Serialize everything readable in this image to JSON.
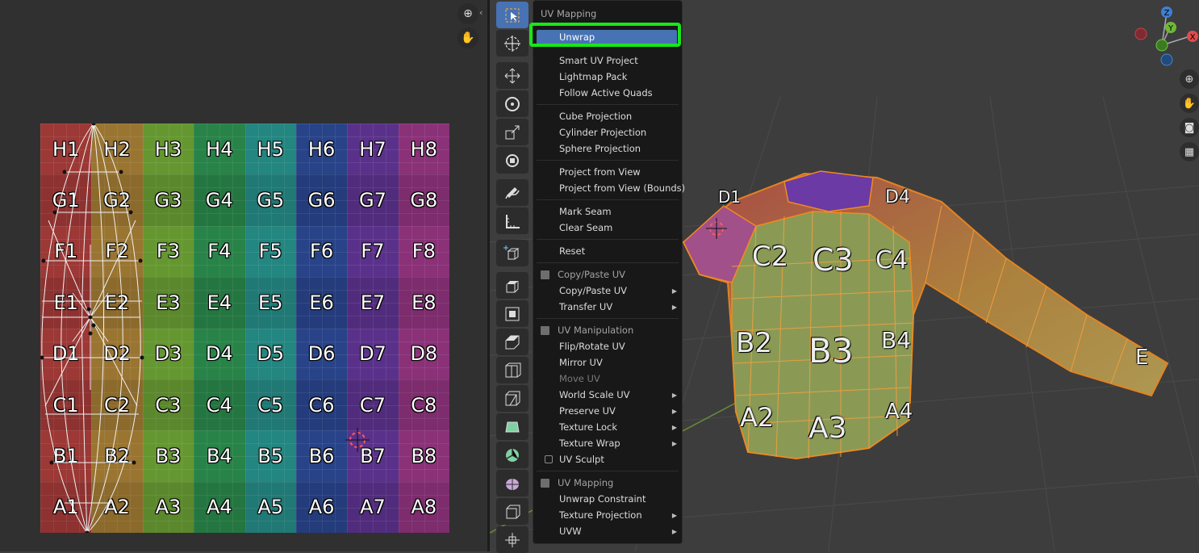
{
  "uv_grid": {
    "rows": [
      [
        "H1",
        "H2",
        "H3",
        "H4",
        "H5",
        "H6",
        "H7",
        "H8"
      ],
      [
        "G1",
        "G2",
        "G3",
        "G4",
        "G5",
        "G6",
        "G7",
        "G8"
      ],
      [
        "F1",
        "F2",
        "F3",
        "F4",
        "F5",
        "F6",
        "F7",
        "F8"
      ],
      [
        "E1",
        "E2",
        "E3",
        "E4",
        "E5",
        "E6",
        "E7",
        "E8"
      ],
      [
        "D1",
        "D2",
        "D3",
        "D4",
        "D5",
        "D6",
        "D7",
        "D8"
      ],
      [
        "C1",
        "C2",
        "C3",
        "C4",
        "C5",
        "C6",
        "C7",
        "C8"
      ],
      [
        "B1",
        "B2",
        "B3",
        "B4",
        "B5",
        "B6",
        "B7",
        "B8"
      ],
      [
        "A1",
        "A2",
        "A3",
        "A4",
        "A5",
        "A6",
        "A7",
        "A8"
      ]
    ],
    "column_colors": [
      "#b8423f",
      "#b68a3a",
      "#77b23a",
      "#2f9a55",
      "#2a9e97",
      "#2f4fa0",
      "#6a3aa3",
      "#a33a8e"
    ]
  },
  "menu": {
    "title": "UV Mapping",
    "items": {
      "unwrap": "Unwrap",
      "smart_uv_project": "Smart UV Project",
      "lightmap_pack": "Lightmap Pack",
      "follow_active_quads": "Follow Active Quads",
      "cube_projection": "Cube Projection",
      "cylinder_projection": "Cylinder Projection",
      "sphere_projection": "Sphere Projection",
      "project_from_view": "Project from View",
      "project_from_view_bounds": "Project from View (Bounds)",
      "mark_seam": "Mark Seam",
      "clear_seam": "Clear Seam",
      "reset": "Reset",
      "copy_paste_header": "Copy/Paste UV",
      "copy_paste_uv": "Copy/Paste UV",
      "transfer_uv": "Transfer UV",
      "uv_manipulation_header": "UV Manipulation",
      "flip_rotate_uv": "Flip/Rotate UV",
      "mirror_uv": "Mirror UV",
      "move_uv": "Move UV",
      "world_scale_uv": "World Scale UV",
      "preserve_uv": "Preserve UV",
      "texture_lock": "Texture Lock",
      "texture_wrap": "Texture Wrap",
      "uv_sculpt": "UV Sculpt",
      "uv_mapping_header": "UV Mapping",
      "unwrap_constraint": "Unwrap Constraint",
      "texture_projection": "Texture Projection",
      "uvw": "UVW"
    }
  },
  "gizmo": {
    "z": "Z",
    "y": "Y",
    "x": "X"
  },
  "shirt_labels": [
    "C2",
    "C3",
    "C4",
    "B2",
    "B3",
    "B4",
    "A2",
    "A3",
    "A4",
    "D1",
    "D4",
    "E"
  ],
  "icons": {
    "uv_zoom": "zoom-icon",
    "uv_pan": "hand-icon",
    "collapse": "chevron-left-icon"
  },
  "colors": {
    "accent": "#4772b3",
    "highlight_box": "#19e619",
    "selection_orange": "#f28a1e"
  }
}
